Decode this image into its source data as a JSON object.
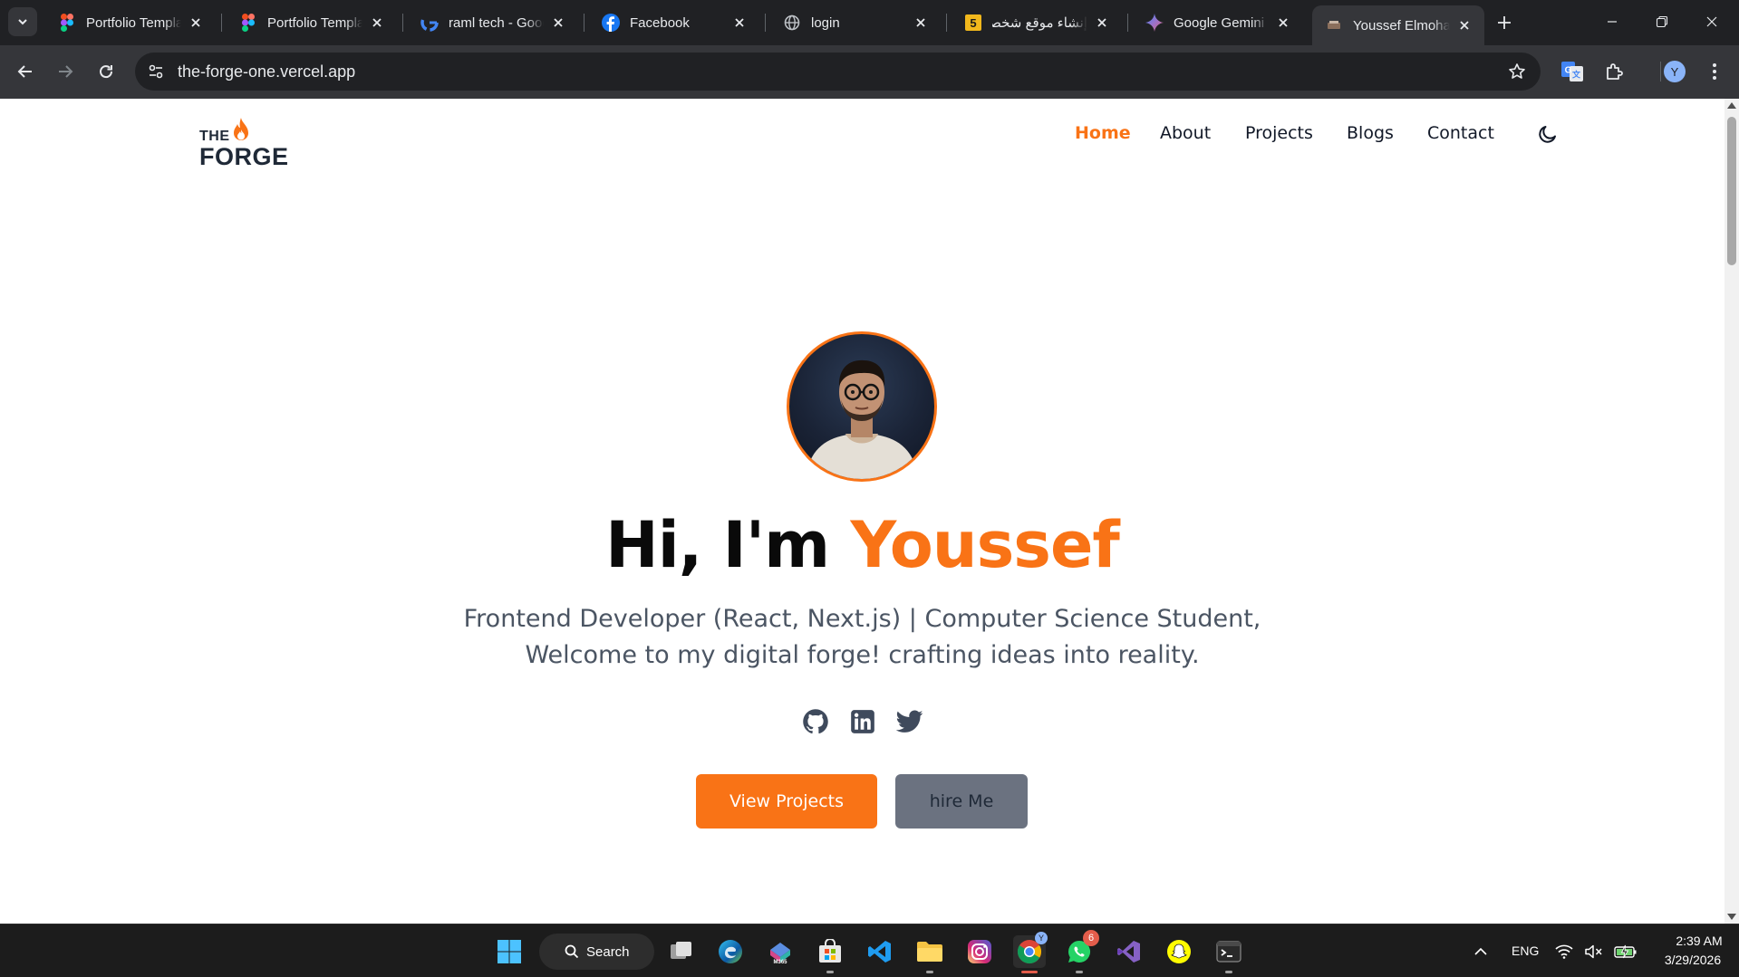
{
  "browser": {
    "tabs": [
      {
        "title": "Portfolio Template",
        "favicon": "figma-icon"
      },
      {
        "title": "Portfolio Template",
        "favicon": "figma-icon"
      },
      {
        "title": "raml tech - Google",
        "favicon": "google-icon"
      },
      {
        "title": "Facebook",
        "favicon": "facebook-icon"
      },
      {
        "title": "login",
        "favicon": "globe-icon"
      },
      {
        "title": "إنشاء موقع شخصي",
        "favicon": "number-5-icon"
      },
      {
        "title": "Google Gemini",
        "favicon": "gemini-icon"
      },
      {
        "title": "Youssef Elmohandes",
        "favicon": "page-icon",
        "active": true
      }
    ],
    "url": "the-forge-one.vercel.app",
    "profile_initial": "Y"
  },
  "site": {
    "logo": {
      "top": "THE",
      "bottom": "FORGE"
    },
    "nav": [
      {
        "label": "Home",
        "active": true
      },
      {
        "label": "About"
      },
      {
        "label": "Projects"
      },
      {
        "label": "Blogs"
      },
      {
        "label": "Contact"
      }
    ],
    "hero": {
      "greeting": "Hi, I'm ",
      "name": "Youssef",
      "subtitle_line1": "Frontend Developer (React, Next.js) | Computer Science Student,",
      "subtitle_line2": "Welcome to my digital forge! crafting ideas into reality.",
      "socials": [
        "github-icon",
        "linkedin-icon",
        "twitter-icon"
      ],
      "primary_button": "View Projects",
      "secondary_button": "hire Me"
    },
    "colors": {
      "accent": "#f97316",
      "text": "#0a0a0a",
      "muted": "#4b5563",
      "secondary_button": "#6b7280"
    }
  },
  "taskbar": {
    "search_label": "Search",
    "whatsapp_badge": "6",
    "language": "ENG",
    "time": "2:39 AM",
    "date": "3/29/2026"
  }
}
